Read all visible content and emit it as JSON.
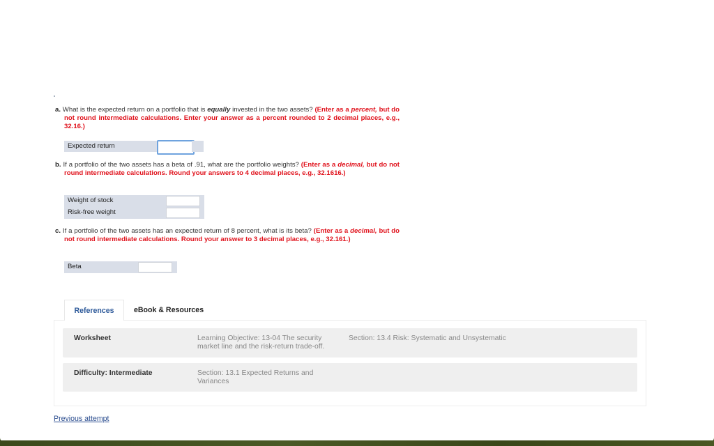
{
  "questions": {
    "a": {
      "label": "a.",
      "text_pre": "What is the expected return on a portfolio that is ",
      "text_emph": "equally",
      "text_post": " invested in the two assets? ",
      "instr_pre": "(Enter as a ",
      "instr_emph": "percent,",
      "instr_post": " but do not round intermediate calculations. Enter your answer as a percent rounded to 2 decimal places, e.g., 32.16.)",
      "fields": [
        {
          "label": "Expected return",
          "value": "",
          "unit": "%"
        }
      ]
    },
    "b": {
      "label": "b.",
      "text": "If a portfolio of the two assets has a beta of .91, what are the portfolio weights? ",
      "instr_pre": "(Enter as a ",
      "instr_emph": "decimal,",
      "instr_post": " but do not round intermediate calculations. Round your answers to 4 decimal places, e.g., 32.1616.)",
      "fields": [
        {
          "label": "Weight of stock",
          "value": ""
        },
        {
          "label": "Risk-free weight",
          "value": ""
        }
      ]
    },
    "c": {
      "label": "c.",
      "text": "If a portfolio of the two assets has an expected return of 8 percent, what is its beta? ",
      "instr_pre": "(Enter as a ",
      "instr_emph": "decimal,",
      "instr_post": " but do not round intermediate calculations. Round your answer to 3 decimal places, e.g., 32.161.)",
      "fields": [
        {
          "label": "Beta",
          "value": ""
        }
      ]
    }
  },
  "tabs": [
    {
      "label": "References",
      "active": true
    },
    {
      "label": "eBook & Resources",
      "active": false
    }
  ],
  "references": {
    "rows": [
      {
        "key": "Worksheet",
        "values": [
          "Learning Objective: 13-04 The security market line and the risk-return trade-off.",
          "Section: 13.4 Risk: Systematic and Unsystematic"
        ]
      },
      {
        "key": "Difficulty: Intermediate",
        "values": [
          "Section: 13.1 Expected Returns and Variances"
        ]
      }
    ]
  },
  "footer": {
    "previous_attempt_label": "Previous attempt"
  },
  "colors": {
    "instruction_red": "#e0121c",
    "link_blue": "#2b4d8f",
    "field_bg": "#d9dee8",
    "focus_blue": "#6fa3de"
  }
}
